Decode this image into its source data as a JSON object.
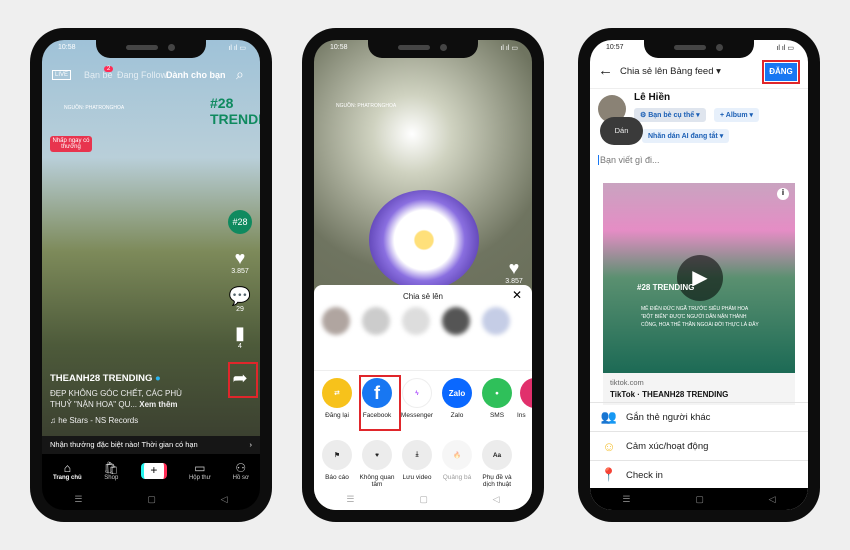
{
  "phone1": {
    "time": "10:58",
    "battery": "92",
    "tabs": {
      "live": "LIVE",
      "friends": "Bạn bè",
      "friends_badge": "2",
      "following": "Đang Follow",
      "for_you": "Dành cho bạn"
    },
    "source_watermark": "NGUỒN: PHATRONGHOA",
    "logo": "#28 TRENDING",
    "promo": "Nhấp ngay có thưởng",
    "likes": "3.857",
    "comments": "29",
    "bookmarks": "4",
    "username": "THEANH28 TRENDING",
    "caption": "ĐẸP KHÔNG GÓC CHẾT, CÁC PHÙ THUỶ \"NẶN HOA\" QU...",
    "see_more": "Xem thêm",
    "music": "♫ he Stars - NS Records",
    "banner": "Nhận thưởng đặc biệt nào! Thời gian có hạn",
    "bottom_nav": [
      {
        "label": "Trang chủ",
        "icon": "home-icon"
      },
      {
        "label": "Shop",
        "icon": "shop-icon"
      },
      {
        "label": "",
        "icon": "create-icon"
      },
      {
        "label": "Hộp thư",
        "icon": "inbox-icon"
      },
      {
        "label": "Hồ sơ",
        "icon": "profile-icon"
      }
    ]
  },
  "phone2": {
    "time": "10:58",
    "battery": "92",
    "source_watermark": "NGUỒN: PHATRONGHOA",
    "likes": "3.857",
    "sheet_title": "Chia sẻ lên",
    "apps": [
      {
        "label": "Đăng lại",
        "color": "#f7c21b",
        "glyph": "⇄"
      },
      {
        "label": "Facebook",
        "color": "#1877f2",
        "glyph": "f"
      },
      {
        "label": "Messenger",
        "color": "#ffffff",
        "glyph": "ϟ"
      },
      {
        "label": "Zalo",
        "color": "#0a68ff",
        "glyph": "Zalo"
      },
      {
        "label": "SMS",
        "color": "#2fc05a",
        "glyph": "●"
      },
      {
        "label": "Ins",
        "color": "#e1306c",
        "glyph": "◎"
      }
    ],
    "actions": [
      {
        "label": "Báo cáo",
        "glyph": "⚑"
      },
      {
        "label": "Không quan tâm",
        "glyph": "♥"
      },
      {
        "label": "Lưu video",
        "glyph": "⤓"
      },
      {
        "label": "Quảng bá",
        "glyph": "🔥"
      },
      {
        "label": "Phụ đề và dịch thuật",
        "glyph": "Aa"
      }
    ]
  },
  "phone3": {
    "time": "10:57",
    "battery": "92",
    "header_title": "Chia sẻ lên Bảng feed",
    "post_button": "ĐĂNG",
    "user_name": "Lê Hiền",
    "audience": "Bạn bè cụ thể",
    "album": "Album",
    "ai_label": "Nhãn dán AI đang tắt",
    "tooltip": "Dán",
    "placeholder": "Bạn viết gì đi...",
    "preview_text": "MÊ ĐIÊN ĐỨC NGÃ TRƯỚC SIÊU PHẨM HOA \"ĐỘT BIẾN\" ĐƯỢC NGƯỜI DÂN NẶN THÀNH CÔNG, HOA THẾ THẦN NGOÀI ĐỜI THỰC LÀ ĐÂY",
    "preview_logo": "#28 TRENDING",
    "link_domain": "tiktok.com",
    "link_title": "TikTok · THEANH28 TRENDING",
    "options": [
      {
        "label": "Gắn thẻ người khác",
        "icon": "tag-people-icon"
      },
      {
        "label": "Cảm xúc/hoạt động",
        "icon": "feeling-icon"
      },
      {
        "label": "Check in",
        "icon": "location-icon"
      }
    ],
    "accent": "#1877f2"
  }
}
